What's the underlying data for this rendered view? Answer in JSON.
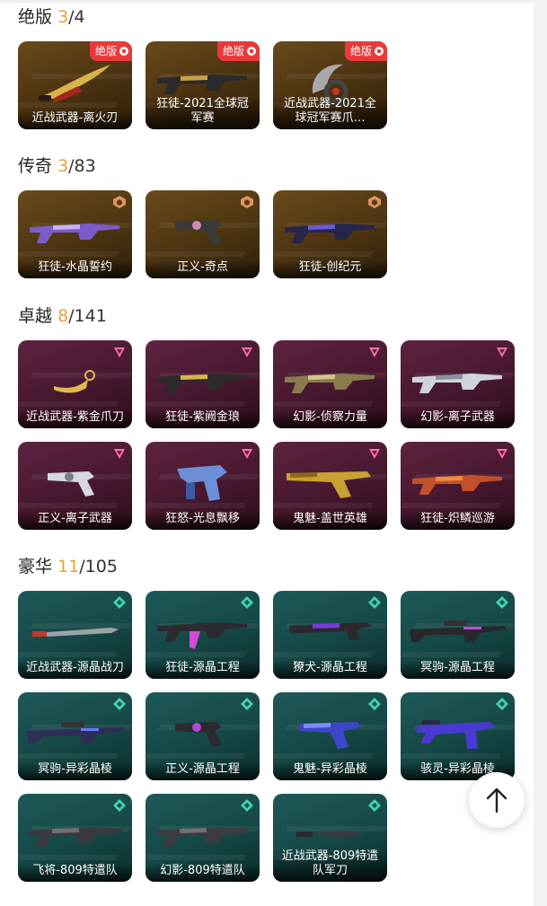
{
  "sections": {
    "jueban": {
      "title": "绝版",
      "owned": "3",
      "total": "/4",
      "badge_label": "绝版",
      "items": [
        "近战武器-离火刃",
        "狂徒-2021全球冠军赛",
        "近战武器-2021全球冠军赛爪…"
      ]
    },
    "chuanqi": {
      "title": "传奇",
      "owned": "3",
      "total": "/83",
      "items": [
        "狂徒-水晶誓约",
        "正义-奇点",
        "狂徒-创纪元"
      ]
    },
    "zhuoyue": {
      "title": "卓越",
      "owned": "8",
      "total": "/141",
      "items": [
        "近战武器-紫金爪刀",
        "狂徒-紫阙金琅",
        "幻影-侦察力量",
        "幻影-离子武器",
        "正义-离子武器",
        "狂怒-光息飘移",
        "鬼魅-盖世英雄",
        "狂徒-炽鳞巡游"
      ]
    },
    "haohua": {
      "title": "豪华",
      "owned": "11",
      "total": "/105",
      "items": [
        "近战武器-源晶战刀",
        "狂徒-源晶工程",
        "獠犬-源晶工程",
        "冥驹-源晶工程",
        "冥驹-异彩晶棱",
        "正义-源晶工程",
        "鬼魅-异彩晶棱",
        "骇灵-异彩晶棱",
        "飞将-809特遣队",
        "幻影-809特遣队",
        "近战武器-809特遣队军刀"
      ]
    }
  },
  "colors": {
    "owned_count": "#e8a23a",
    "jueban_badge": "#e83a3a",
    "legendary_icon": "#e0935a",
    "premium_icon": "#ff6fa3",
    "deluxe_icon": "#3fd1b3"
  },
  "back_to_top_icon": "arrow-up-icon"
}
